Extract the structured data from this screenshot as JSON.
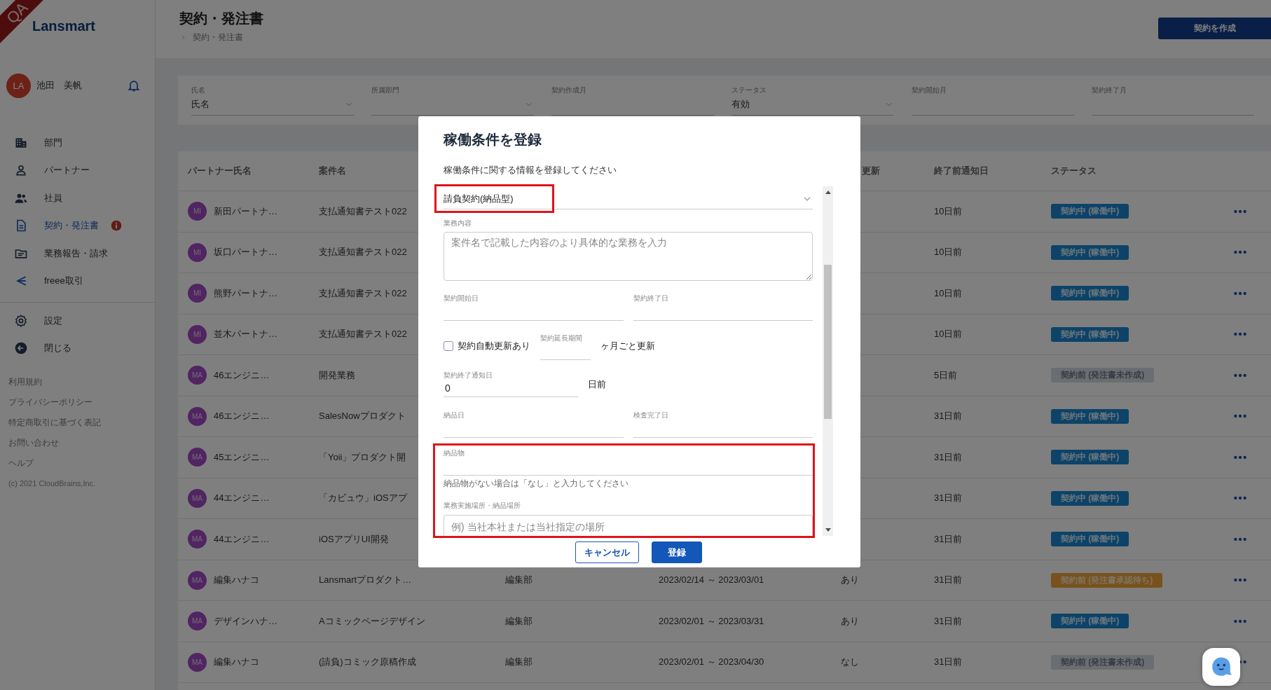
{
  "sidebar": {
    "ribbon": "QA",
    "logo": "Lansmart",
    "user": {
      "initials": "LA",
      "name": "池田　美帆"
    },
    "nav": [
      {
        "label": "部門",
        "selected": false,
        "alert": false
      },
      {
        "label": "パートナー",
        "selected": false,
        "alert": false
      },
      {
        "label": "社員",
        "selected": false,
        "alert": false
      },
      {
        "label": "契約・発注書",
        "selected": true,
        "alert": true
      },
      {
        "label": "業務報告・請求",
        "selected": false,
        "alert": false
      },
      {
        "label": "freee取引",
        "selected": false,
        "alert": false
      }
    ],
    "settings": [
      {
        "label": "設定"
      },
      {
        "label": "閉じる"
      }
    ],
    "links": [
      "利用規約",
      "プライバシーポリシー",
      "特定商取引に基づく表記",
      "お問い合わせ",
      "ヘルプ"
    ],
    "copyright": "(c) 2021 CloudBrains,Inc."
  },
  "page": {
    "title": "契約・発注書",
    "breadcrumb": "契約・発注書",
    "create_button": "契約を作成"
  },
  "filters": [
    {
      "label": "氏名",
      "value": "氏名",
      "dropdown": true
    },
    {
      "label": "所属部門",
      "dropdown": true
    },
    {
      "label": "契約作成月",
      "dropdown": false
    },
    {
      "label": "ステータス",
      "value": "有効",
      "dropdown": true
    },
    {
      "label": "契約開始月",
      "dropdown": false
    },
    {
      "label": "契約終了月",
      "dropdown": false
    }
  ],
  "table": {
    "columns": [
      "パートナー氏名",
      "案件名",
      "更新",
      "終了前通知日",
      "ステータス"
    ],
    "rows": [
      {
        "avatar": "MI",
        "partner": "新田パートナ…",
        "project": "支払通知書テスト022",
        "notice": "10日前",
        "status": {
          "label": "契約中 (稼働中)",
          "kind": "active"
        }
      },
      {
        "avatar": "MI",
        "partner": "坂口パートナ…",
        "project": "支払通知書テスト022",
        "notice": "10日前",
        "status": {
          "label": "契約中 (稼働中)",
          "kind": "active"
        }
      },
      {
        "avatar": "MI",
        "partner": "熊野パートナ…",
        "project": "支払通知書テスト022",
        "notice": "10日前",
        "status": {
          "label": "契約中 (稼働中)",
          "kind": "active"
        }
      },
      {
        "avatar": "MI",
        "partner": "並木パートナ…",
        "project": "支払通知書テスト022",
        "notice": "10日前",
        "status": {
          "label": "契約中 (稼働中)",
          "kind": "active"
        }
      },
      {
        "avatar": "MA",
        "partner": "46エンジニ…",
        "project": "開発業務",
        "notice": "5日前",
        "status": {
          "label": "契約前 (発注書未作成)",
          "kind": "draft"
        }
      },
      {
        "avatar": "MA",
        "partner": "46エンジニ…",
        "project": "SalesNowプロダクト",
        "notice": "31日前",
        "status": {
          "label": "契約中 (稼働中)",
          "kind": "active"
        }
      },
      {
        "avatar": "MA",
        "partner": "45エンジニ…",
        "project": "「Yoii」プロダクト開",
        "notice": "31日前",
        "status": {
          "label": "契約中 (稼働中)",
          "kind": "active"
        }
      },
      {
        "avatar": "MA",
        "partner": "44エンジニ…",
        "project": "「カビュウ」iOSアプ",
        "notice": "31日前",
        "status": {
          "label": "契約中 (稼働中)",
          "kind": "active"
        }
      },
      {
        "avatar": "MA",
        "partner": "44エンジニ…",
        "project": "iOSアプリUI開発",
        "notice": "31日前",
        "status": {
          "label": "契約中 (稼働中)",
          "kind": "active"
        }
      },
      {
        "avatar": "MA",
        "partner": "編集ハナコ",
        "project": "Lansmartプロダクト…",
        "department": "編集部",
        "period": "2023/02/14 ～ 2023/03/01",
        "renewal": "あり",
        "notice": "31日前",
        "status": {
          "label": "契約前 (発注書承認待ち)",
          "kind": "pending"
        }
      },
      {
        "avatar": "MA",
        "partner": "デザインハナ…",
        "project": "Aコミックページデザイン",
        "department": "編集部",
        "period": "2023/02/01 ～ 2023/03/31",
        "renewal": "あり",
        "notice": "31日前",
        "status": {
          "label": "契約中 (稼働中)",
          "kind": "active"
        }
      },
      {
        "avatar": "MA",
        "partner": "編集ハナコ",
        "project": "(請負)コミック原稿作成",
        "department": "編集部",
        "period": "2023/02/01 ～ 2023/04/30",
        "renewal": "なし",
        "notice": "31日前",
        "status": {
          "label": "契約前 (発注書未作成)",
          "kind": "draft"
        }
      }
    ]
  },
  "modal": {
    "title": "稼働条件を登録",
    "subtitle": "稼働条件に関する情報を登録してください",
    "form": [
      {
        "kind": "select",
        "value": "請負契約(納品型)",
        "highlighted": true
      },
      {
        "kind": "textarea",
        "label": "業務内容",
        "placeholder": "案件名で記載した内容のより具体的な業務を入力",
        "highlighted": false
      },
      {
        "kind": "pair",
        "fields": [
          {
            "label": "契約開始日"
          },
          {
            "label": "契約終了日"
          }
        ],
        "highlighted": false
      },
      {
        "kind": "renewal",
        "checkbox": {
          "label": "契約自動更新あり",
          "checked": false
        },
        "field": {
          "label": "契約延長期間"
        },
        "suffix": "ヶ月ごと更新",
        "highlighted": false
      },
      {
        "kind": "short",
        "label": "契約終了通知日",
        "value": "0",
        "suffix": "日前",
        "highlighted": false
      },
      {
        "kind": "pair",
        "fields": [
          {
            "label": "納品日"
          },
          {
            "label": "検査完了日"
          }
        ],
        "highlighted": false
      },
      {
        "kind": "group",
        "highlighted": true,
        "items": [
          {
            "kind": "line",
            "label": "納品物",
            "helper": "納品物がない場合は「なし」と入力してください"
          },
          {
            "kind": "outlined",
            "label": "業務実施場所・納品場所",
            "placeholder": "例) 当社本社または当社指定の場所"
          }
        ]
      }
    ],
    "buttons": [
      {
        "label": "キャンセル",
        "kind": "secondary"
      },
      {
        "label": "登録",
        "kind": "primary"
      }
    ]
  }
}
